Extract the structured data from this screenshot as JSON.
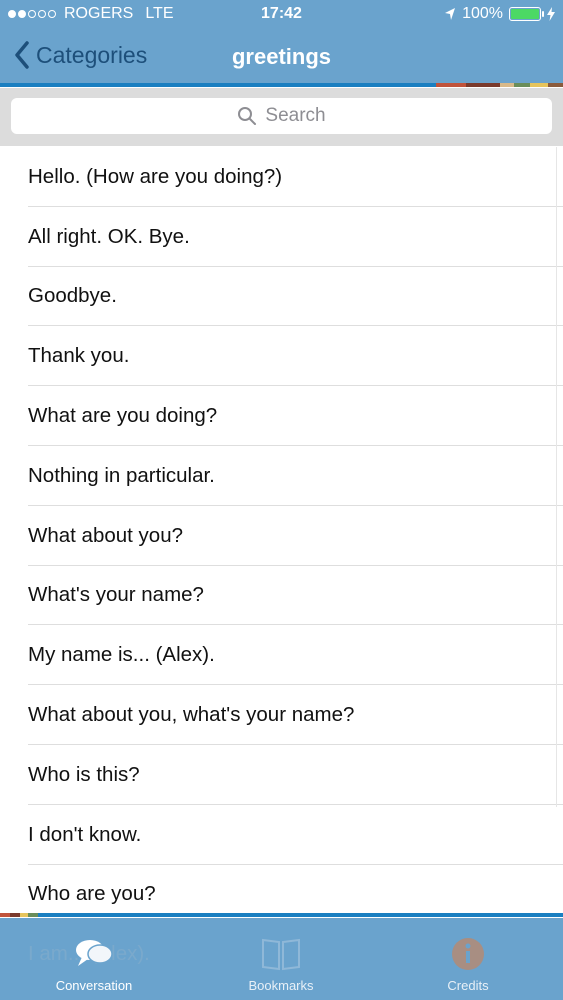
{
  "status_bar": {
    "carrier": "ROGERS",
    "network": "LTE",
    "time": "17:42",
    "battery": "100%",
    "signal_bars_filled": 2,
    "signal_bars_total": 5
  },
  "nav": {
    "back_label": "Categories",
    "title": "greetings"
  },
  "search": {
    "placeholder": "Search"
  },
  "phrases": [
    "Hello. (How are you doing?)",
    "All right. OK. Bye.",
    "Goodbye.",
    "Thank you.",
    "What are you doing?",
    "Nothing in particular.",
    "What about you?",
    "What's your name?",
    "My name is... (Alex).",
    "What about you, what's your name?",
    "Who is this?",
    "I don't know.",
    "Who are you?"
  ],
  "partially_hidden_phrase": "I am... (Alex).",
  "tabs": [
    {
      "label": "Conversation",
      "icon": "speech-bubbles-icon",
      "active": true
    },
    {
      "label": "Bookmarks",
      "icon": "book-icon",
      "active": false
    },
    {
      "label": "Credits",
      "icon": "info-circle-icon",
      "active": false
    }
  ],
  "colors": {
    "bar_background": "#6aa3cd",
    "back_label": "#1d4f7a",
    "stripe_blue": "#1a7fc1",
    "battery": "#4cd964"
  }
}
